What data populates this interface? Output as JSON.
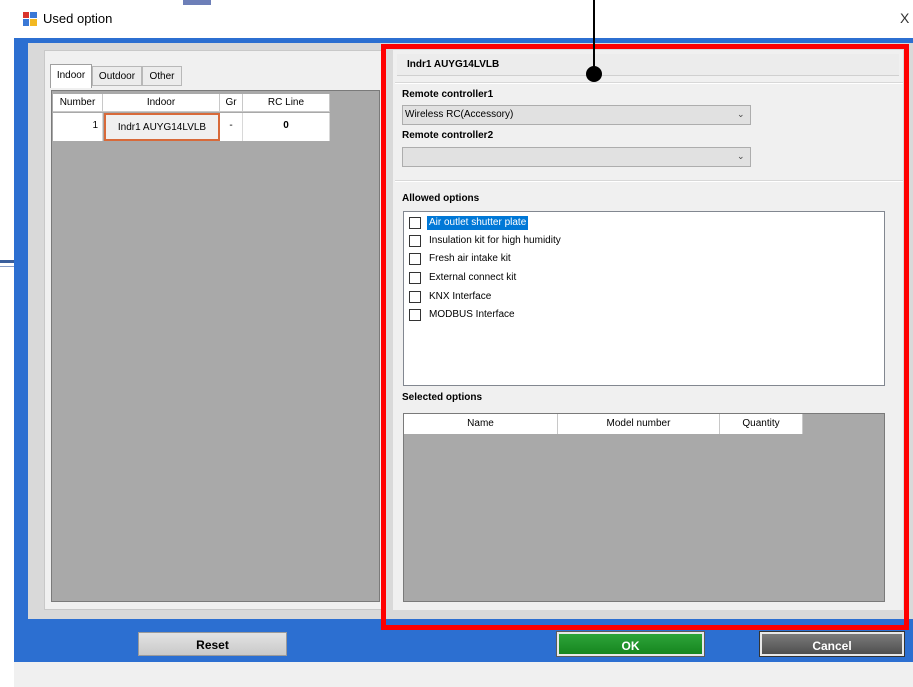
{
  "window": {
    "title": "Used option",
    "close_glyph": "X"
  },
  "tabs": [
    "Indoor",
    "Outdoor",
    "Other"
  ],
  "indoor_table": {
    "headers": [
      "Number",
      "Indoor",
      "Gr",
      "RC Line"
    ],
    "rows": [
      {
        "number": "1",
        "indoor": "Indr1 AUYG14LVLB",
        "gr": "-",
        "rc_line": "0"
      }
    ]
  },
  "details": {
    "unit_title": "Indr1 AUYG14LVLB",
    "rc1_label": "Remote controller1",
    "rc1_value": "Wireless RC(Accessory)",
    "rc2_label": "Remote controller2",
    "rc2_value": "",
    "allowed_label": "Allowed options",
    "allowed_options": [
      {
        "label": "Air outlet shutter plate",
        "checked": false,
        "highlighted": true
      },
      {
        "label": "Insulation kit for high humidity",
        "checked": false,
        "highlighted": false
      },
      {
        "label": "Fresh air intake kit",
        "checked": false,
        "highlighted": false
      },
      {
        "label": "External connect kit",
        "checked": false,
        "highlighted": false
      },
      {
        "label": "KNX Interface",
        "checked": false,
        "highlighted": false
      },
      {
        "label": "MODBUS Interface",
        "checked": false,
        "highlighted": false
      }
    ],
    "selected_label": "Selected options",
    "selected_headers": [
      "Name",
      "Model number",
      "Quantity"
    ]
  },
  "buttons": {
    "reset": "Reset",
    "ok": "OK",
    "cancel": "Cancel"
  },
  "icons": {
    "app": "window-app-icon",
    "dropdown": "chevron-down-icon"
  },
  "colors": {
    "frame": "#2c6fd1",
    "annotation": "#ff0000",
    "ok": "#1c9a2a",
    "cancel": "#5e5e5e",
    "highlight": "#0078d7"
  }
}
